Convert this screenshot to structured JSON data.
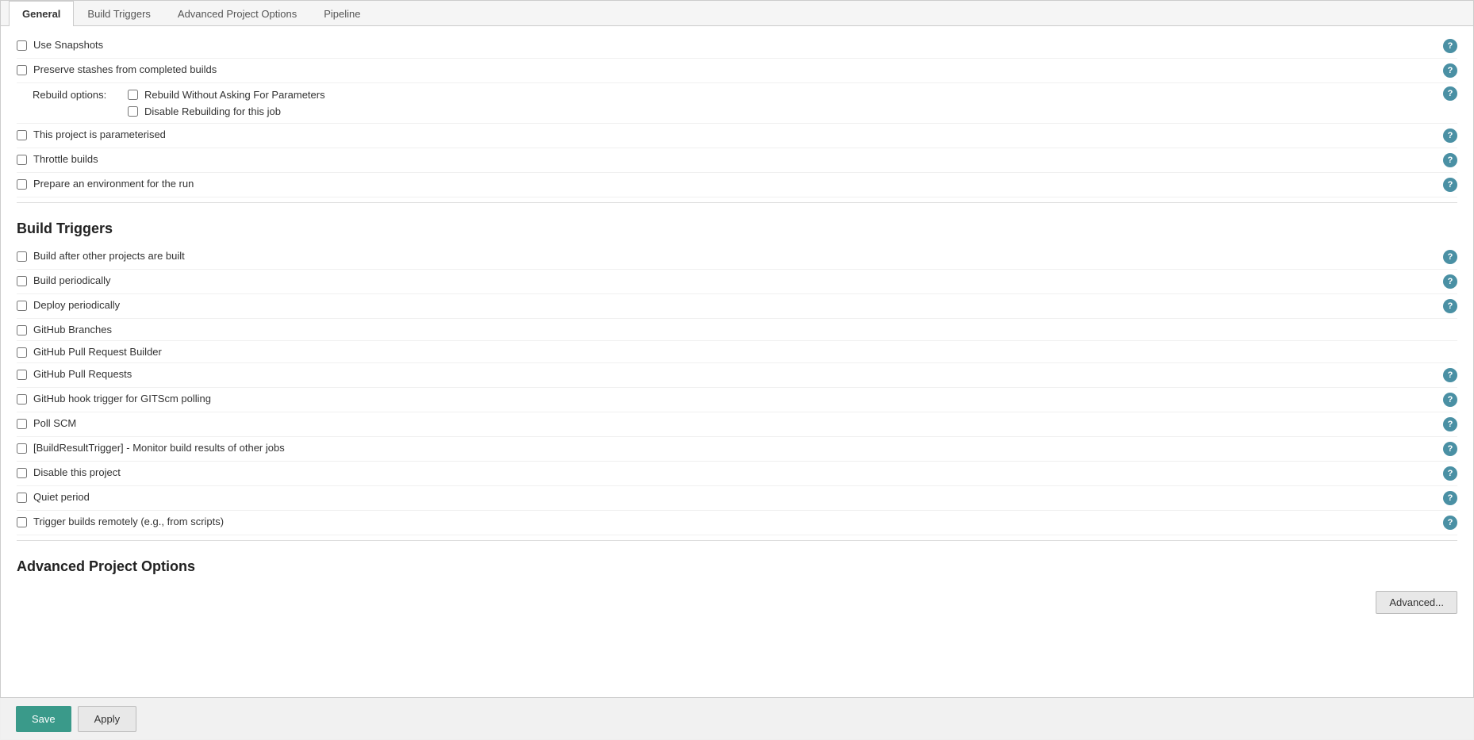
{
  "tabs": [
    {
      "label": "General",
      "active": true
    },
    {
      "label": "Build Triggers",
      "active": false
    },
    {
      "label": "Advanced Project Options",
      "active": false
    },
    {
      "label": "Pipeline",
      "active": false
    }
  ],
  "general": {
    "checkboxes": [
      {
        "label": "Use Snapshots",
        "checked": false,
        "has_help": true
      },
      {
        "label": "Preserve stashes from completed builds",
        "checked": false,
        "has_help": true
      }
    ],
    "rebuild_options_label": "Rebuild options:",
    "rebuild_options": [
      {
        "label": "Rebuild Without Asking For Parameters",
        "checked": false
      },
      {
        "label": "Disable Rebuilding for this job",
        "checked": false
      }
    ],
    "rebuild_has_help": true,
    "more_checkboxes": [
      {
        "label": "This project is parameterised",
        "checked": false,
        "has_help": true
      },
      {
        "label": "Throttle builds",
        "checked": false,
        "has_help": true
      },
      {
        "label": "Prepare an environment for the run",
        "checked": false,
        "has_help": true
      }
    ]
  },
  "build_triggers": {
    "section_title": "Build Triggers",
    "items": [
      {
        "label": "Build after other projects are built",
        "checked": false,
        "has_help": true
      },
      {
        "label": "Build periodically",
        "checked": false,
        "has_help": true
      },
      {
        "label": "Deploy periodically",
        "checked": false,
        "has_help": true
      },
      {
        "label": "GitHub Branches",
        "checked": false,
        "has_help": false
      },
      {
        "label": "GitHub Pull Request Builder",
        "checked": false,
        "has_help": false
      },
      {
        "label": "GitHub Pull Requests",
        "checked": false,
        "has_help": true
      },
      {
        "label": "GitHub hook trigger for GITScm polling",
        "checked": false,
        "has_help": true
      },
      {
        "label": "Poll SCM",
        "checked": false,
        "has_help": true
      },
      {
        "label": "[BuildResultTrigger] - Monitor build results of other jobs",
        "checked": false,
        "has_help": true
      },
      {
        "label": "Disable this project",
        "checked": false,
        "has_help": true
      },
      {
        "label": "Quiet period",
        "checked": false,
        "has_help": true
      },
      {
        "label": "Trigger builds remotely (e.g., from scripts)",
        "checked": false,
        "has_help": true
      }
    ]
  },
  "advanced_project_options": {
    "section_title": "Advanced Project Options",
    "advanced_button_label": "Advanced..."
  },
  "buttons": {
    "save_label": "Save",
    "apply_label": "Apply"
  }
}
